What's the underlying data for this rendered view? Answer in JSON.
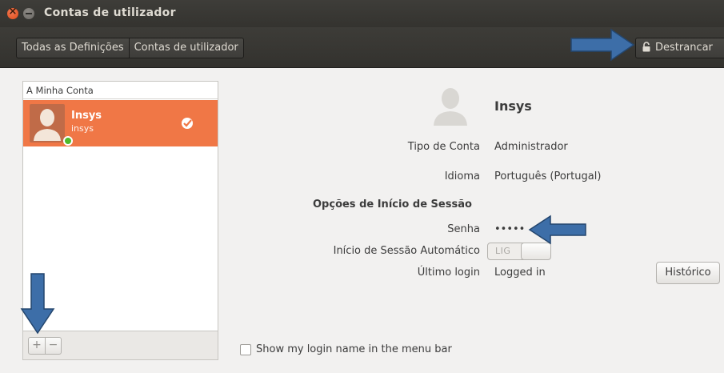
{
  "window": {
    "title": "Contas de utilizador"
  },
  "toolbar": {
    "breadcrumbs": [
      "Todas as Definições",
      "Contas de utilizador"
    ],
    "unlock_label": "Destrancar"
  },
  "accounts_list": {
    "section_header": "A Minha Conta",
    "users": [
      {
        "name": "Insys",
        "login": "insys",
        "online": true,
        "selected": true
      }
    ],
    "add_label": "+",
    "remove_label": "−"
  },
  "details": {
    "name": "Insys",
    "account_type_label": "Tipo de Conta",
    "account_type_value": "Administrador",
    "language_label": "Idioma",
    "language_value": "Português (Portugal)",
    "login_options_title": "Opções de Início de Sessão",
    "password_label": "Senha",
    "password_value": "•••••",
    "auto_login_label": "Início de Sessão Automático",
    "auto_login_toggle_text": "LIG",
    "last_login_label": "Último login",
    "last_login_value": "Logged in",
    "history_button": "Histórico"
  },
  "footer": {
    "show_login_name_label": "Show my login name in the menu bar",
    "show_login_name_checked": false
  },
  "colors": {
    "accent": "#f07746",
    "online": "#4fbb2a",
    "annotation_arrow": "#3d6ea8"
  },
  "icons": [
    "close-icon",
    "minimize-icon",
    "lock-icon",
    "user-avatar-icon",
    "check-icon",
    "plus-icon",
    "minus-icon",
    "arrow-annotation-icon"
  ]
}
